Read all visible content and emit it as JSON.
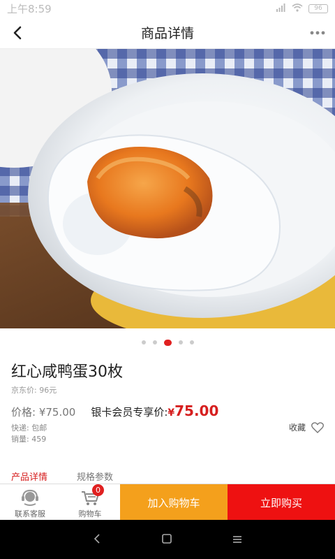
{
  "status_bar": {
    "time": "上午8:59",
    "battery": "96"
  },
  "header": {
    "title": "商品详情"
  },
  "carousel": {
    "count": 5,
    "active_index": 2
  },
  "product": {
    "title": "红心咸鸭蛋30枚",
    "jd_price": "京东价: 96元",
    "price_label": "价格: ¥75.00",
    "member_label": "银卡会员专享价:",
    "member_price_symbol": "¥",
    "member_price": "75.00",
    "shipping": "快递: 包邮",
    "sales": "销量: 459",
    "favorite_label": "收藏"
  },
  "tabs": [
    {
      "label": "产品详情",
      "active": true
    },
    {
      "label": "规格参数",
      "active": false
    }
  ],
  "bottom_bar": {
    "service_label": "联系客服",
    "cart_label": "购物车",
    "cart_count": "0",
    "add_to_cart": "加入购物车",
    "buy_now": "立即购买"
  },
  "colors": {
    "accent_red": "#ee1111",
    "cart_orange": "#f4a01c",
    "price_red": "#d61f1f"
  },
  "icons": [
    "back-arrow-icon",
    "more-dots-icon",
    "heart-icon",
    "headset-icon",
    "cart-icon"
  ]
}
